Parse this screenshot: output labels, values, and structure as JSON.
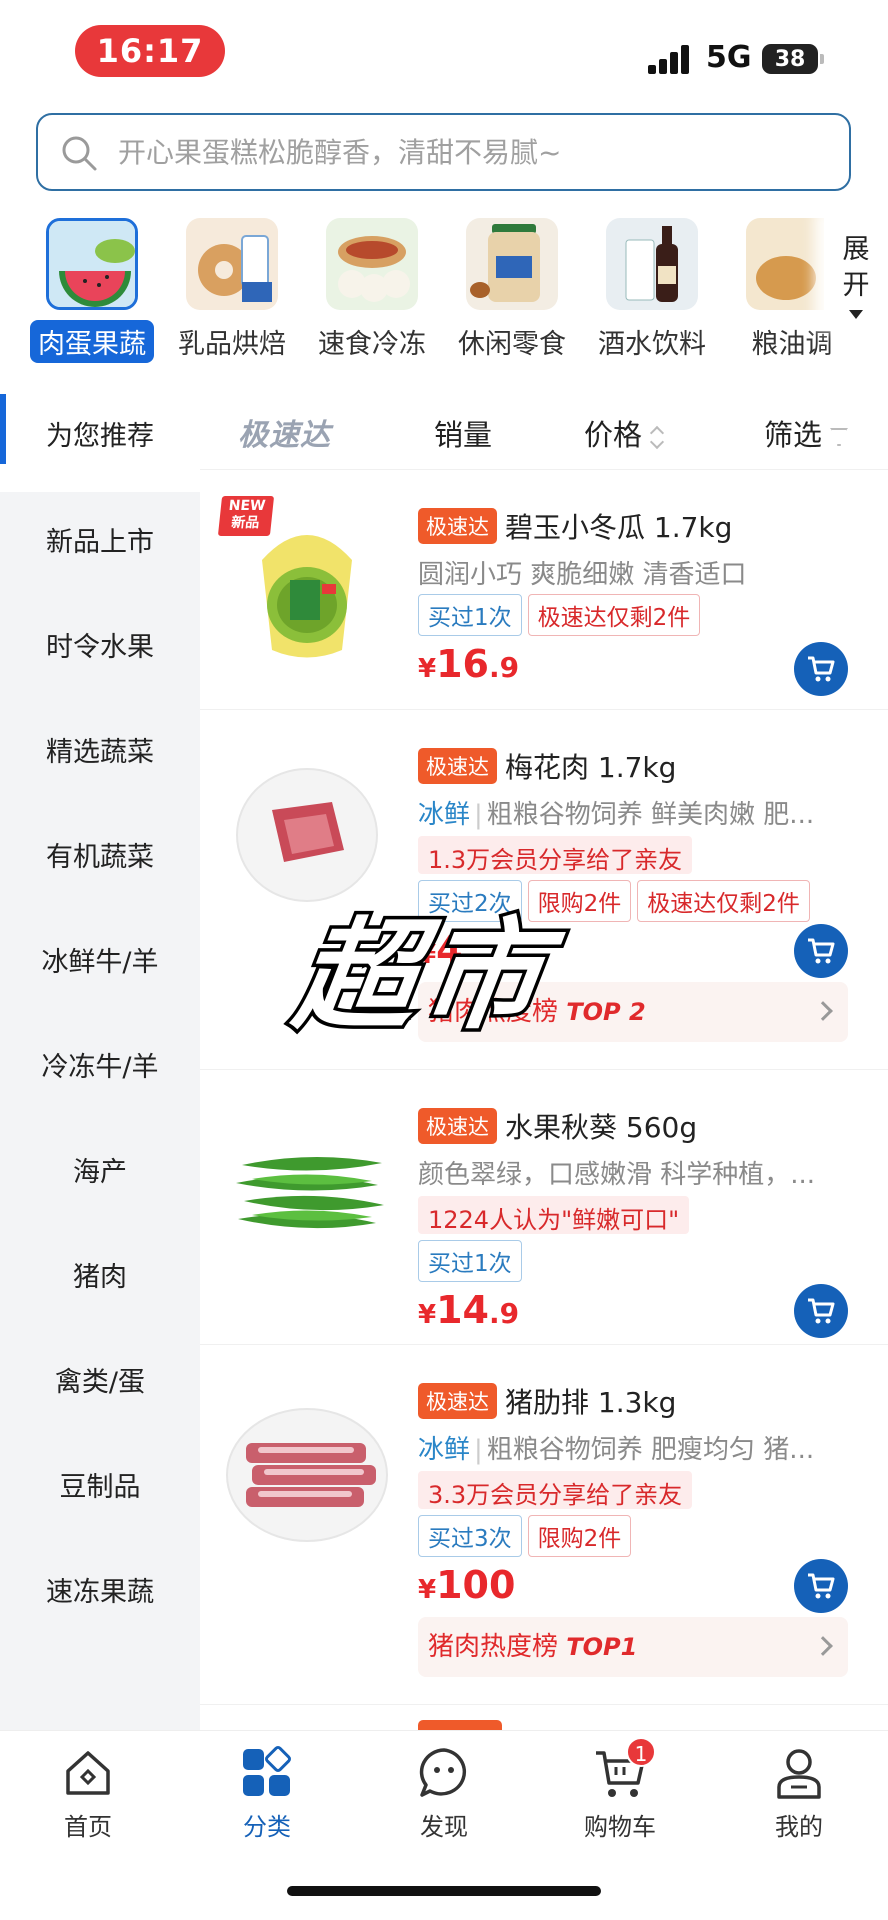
{
  "status_bar": {
    "time": "16:17",
    "network": "5G",
    "battery": "38"
  },
  "search": {
    "placeholder": "开心果蛋糕松脆醇香，清甜不易腻~"
  },
  "top_categories": [
    {
      "label": "肉蛋果蔬",
      "active": true
    },
    {
      "label": "乳品烘焙",
      "active": false
    },
    {
      "label": "速食冷冻",
      "active": false
    },
    {
      "label": "休闲零食",
      "active": false
    },
    {
      "label": "酒水饮料",
      "active": false
    },
    {
      "label": "粮油调",
      "active": false
    }
  ],
  "expand_label": "展开",
  "side_nav": {
    "active": "为您推荐",
    "items": [
      "新品上市",
      "时令水果",
      "精选蔬菜",
      "有机蔬菜",
      "冰鲜牛/羊",
      "冷冻牛/羊",
      "海产",
      "猪肉",
      "禽类/蛋",
      "豆制品",
      "速冻果蔬"
    ]
  },
  "sort_bar": {
    "logo": "极速达",
    "sales": "销量",
    "price": "价格",
    "filter": "筛选"
  },
  "products": [
    {
      "new_badge_top": "NEW",
      "new_badge_bottom": "新品",
      "speed_tag": "极速达",
      "name": "碧玉小冬瓜 1.7kg",
      "desc": "圆润小巧 爽脆细嫩 清香适口",
      "tags": [
        "买过1次",
        "极速达仅剩2件"
      ],
      "price_currency": "¥",
      "price_int": "16",
      "price_dec": ".9"
    },
    {
      "speed_tag": "极速达",
      "name": "梅花肉 1.7kg",
      "fresh": "冰鲜",
      "desc": "粗粮谷物饲养 鲜美肉嫩 肥...",
      "social": "1.3万会员分享给了亲友",
      "tags": [
        "买过2次",
        "限购2件",
        "极速达仅剩2件"
      ],
      "price_currency": "¥",
      "price_int": "4",
      "price_dec": "",
      "rank_text": "猪肉热度榜",
      "rank_top": "TOP 2"
    },
    {
      "speed_tag": "极速达",
      "name": "水果秋葵 560g",
      "desc": "颜色翠绿，口感嫩滑 科学种植，...",
      "social": "1224人认为\"鲜嫩可口\"",
      "tags": [
        "买过1次"
      ],
      "price_currency": "¥",
      "price_int": "14",
      "price_dec": ".9"
    },
    {
      "speed_tag": "极速达",
      "name": "猪肋排 1.3kg",
      "fresh": "冰鲜",
      "desc": "粗粮谷物饲养 肥瘦均匀 猪...",
      "social": "3.3万会员分享给了亲友",
      "tags": [
        "买过3次",
        "限购2件"
      ],
      "price_currency": "¥",
      "price_int": "100",
      "price_dec": "",
      "rank_text": "猪肉热度榜",
      "rank_top": "TOP1"
    }
  ],
  "overlay_text": "超市",
  "tab_bar": {
    "items": [
      "首页",
      "分类",
      "发现",
      "购物车",
      "我的"
    ],
    "active": "分类",
    "cart_badge": "1"
  },
  "colors": {
    "brand_blue": "#1561b8",
    "price_red": "#e8282c",
    "speed_orange": "#ef5a2a"
  }
}
